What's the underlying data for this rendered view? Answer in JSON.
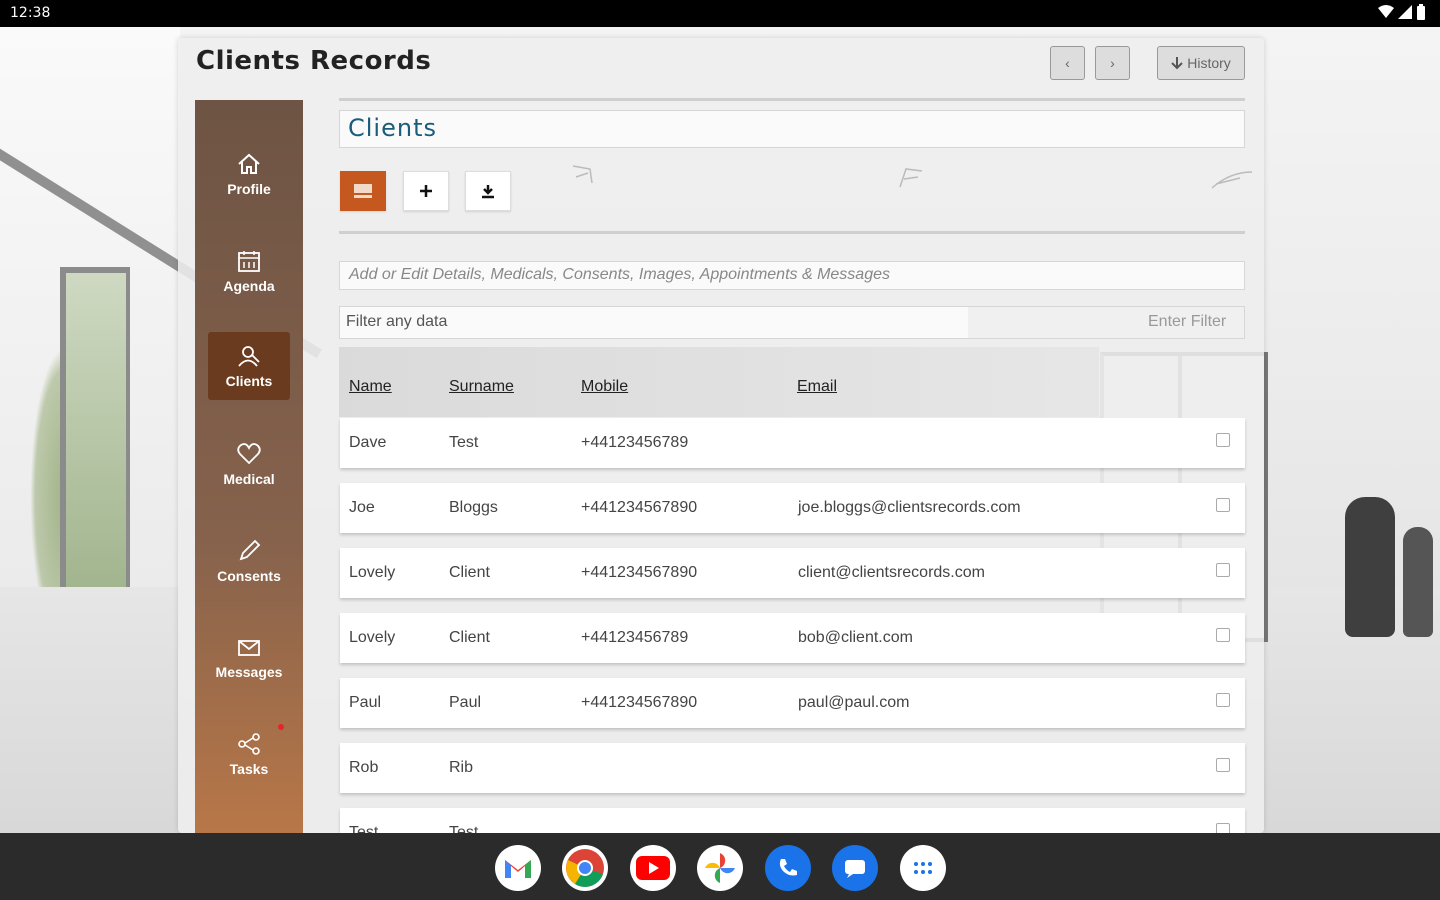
{
  "status_bar": {
    "time": "12:38"
  },
  "header": {
    "title": "Clients Records",
    "prev_label": "‹",
    "next_label": "›",
    "history_label": "History"
  },
  "sidebar": {
    "items": [
      {
        "label": "Profile",
        "icon": "home-icon"
      },
      {
        "label": "Agenda",
        "icon": "calendar-icon"
      },
      {
        "label": "Clients",
        "icon": "clients-icon",
        "active": true
      },
      {
        "label": "Medical",
        "icon": "heart-icon"
      },
      {
        "label": "Consents",
        "icon": "pen-icon"
      },
      {
        "label": "Messages",
        "icon": "mail-icon"
      },
      {
        "label": "Tasks",
        "icon": "share-icon",
        "notification": true
      }
    ]
  },
  "main": {
    "section_title": "Clients",
    "hint": "Add or Edit Details, Medicals, Consents, Images, Appointments & Messages",
    "filter": {
      "label": "Filter any data",
      "placeholder": "Enter Filter"
    },
    "table": {
      "columns": [
        "Name",
        "Surname",
        "Mobile",
        "Email"
      ],
      "rows": [
        {
          "name": "Dave",
          "surname": "Test",
          "mobile": "+44123456789",
          "email": ""
        },
        {
          "name": "Joe",
          "surname": "Bloggs",
          "mobile": "+441234567890",
          "email": "joe.bloggs@clientsrecords.com"
        },
        {
          "name": "Lovely",
          "surname": "Client",
          "mobile": "+441234567890",
          "email": "client@clientsrecords.com"
        },
        {
          "name": "Lovely",
          "surname": "Client",
          "mobile": "+44123456789",
          "email": "bob@client.com"
        },
        {
          "name": "Paul",
          "surname": "Paul",
          "mobile": "+441234567890",
          "email": "paul@paul.com"
        },
        {
          "name": "Rob",
          "surname": "Rib",
          "mobile": "",
          "email": ""
        },
        {
          "name": "Test",
          "surname": "Test",
          "mobile": "",
          "email": ""
        }
      ]
    }
  },
  "dock": {
    "apps": [
      "gmail-icon",
      "chrome-icon",
      "youtube-icon",
      "photos-icon",
      "phone-icon",
      "messages-icon",
      "app-drawer-icon"
    ]
  },
  "colors": {
    "accent": "#c4581e",
    "sidebar_top": "#6e5444",
    "sidebar_bottom": "#b87748",
    "title": "#1a5d7a"
  }
}
